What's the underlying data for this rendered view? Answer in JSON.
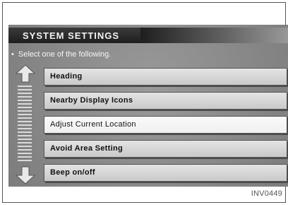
{
  "screen": {
    "title": "SYSTEM SETTINGS",
    "instruction": "Select one of the following.",
    "menu_items": [
      {
        "label": "Heading",
        "selected": false
      },
      {
        "label": "Nearby Display Icons",
        "selected": false
      },
      {
        "label": "Adjust Current Location",
        "selected": true
      },
      {
        "label": "Avoid Area Setting",
        "selected": false
      },
      {
        "label": "Beep on/off",
        "selected": false
      }
    ],
    "scroll_icons": {
      "up": "up-arrow-icon",
      "down": "down-arrow-icon"
    }
  },
  "figure_code": "INV0449"
}
